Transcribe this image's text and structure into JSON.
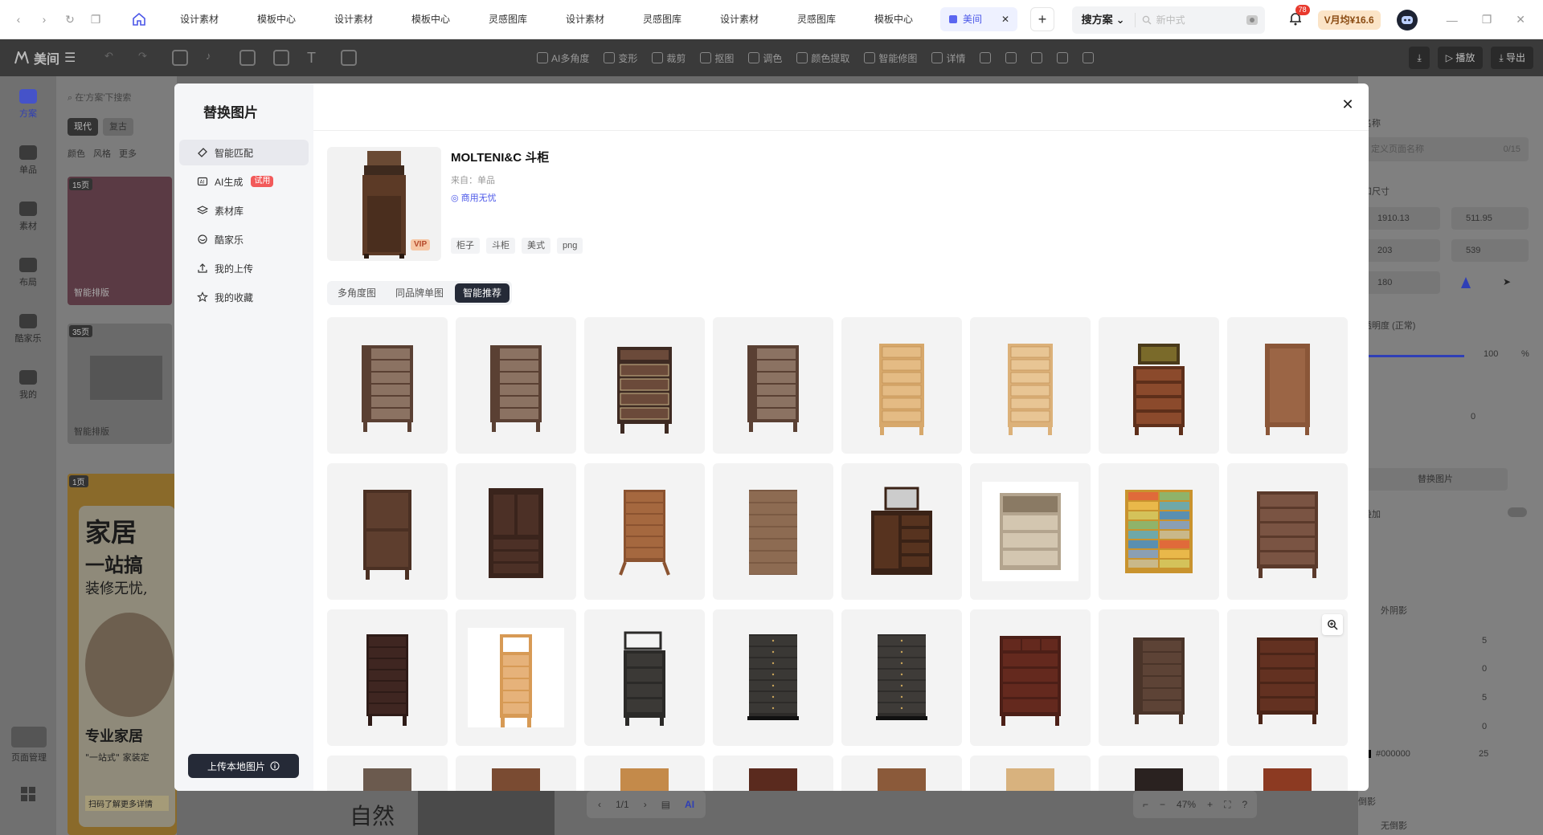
{
  "browser": {
    "tabs": [
      "设计素材",
      "模板中心",
      "设计素材",
      "模板中心",
      "灵感图库",
      "设计素材",
      "灵感图库",
      "设计素材",
      "灵感图库",
      "模板中心"
    ],
    "active_tab": "美间",
    "search_scope": "搜方案",
    "search_placeholder": "新中式",
    "notification_count": "78",
    "vip_label": "V月均¥16.6"
  },
  "app": {
    "logo": "美间",
    "tools": [
      "AI多角度",
      "变形",
      "裁剪",
      "抠图",
      "调色",
      "颜色提取",
      "智能修图",
      "详情"
    ],
    "play_label": "播放",
    "export_label": "导出"
  },
  "rail": [
    {
      "label": "方案",
      "active": true
    },
    {
      "label": "单品"
    },
    {
      "label": "素材"
    },
    {
      "label": "布局"
    },
    {
      "label": "酷家乐"
    },
    {
      "label": "我的"
    }
  ],
  "left_panel": {
    "search_placeholder": "在'方案'下搜索",
    "filters": [
      "现代",
      "复古"
    ],
    "dropdowns": [
      "颜色",
      "风格",
      "更多"
    ],
    "badges": [
      "15页",
      "35页",
      "1页"
    ],
    "smart_layout": "智能排版",
    "page_manage": "页面管理",
    "card_texts": [
      "家居",
      "一站搞",
      "装修无忧,",
      "专业家居",
      "\"一站式\" 家装定",
      "扫码了解更多详情"
    ]
  },
  "right_panel": {
    "name_label": "名称",
    "name_placeholder": "定义页面名称",
    "name_count": "0/15",
    "size_label": "和尺寸",
    "width": "1910.13",
    "height": "511.95",
    "x": "203",
    "y": "539",
    "rotate": "180",
    "opacity_label": "透明度 (正常)",
    "opacity_value": "100",
    "opacity_unit": "%",
    "other_value": "0",
    "replace_label": "替换图片",
    "overlay_label": "叠加",
    "shadow_label": "外阴影",
    "shadow_values": [
      "5",
      "0",
      "5",
      "0"
    ],
    "shadow_color": "#000000",
    "shadow_opacity": "25",
    "projection_label": "倒影",
    "projection_value": "无倒影"
  },
  "canvas": {
    "page": "1/1",
    "zoom": "47%",
    "text_big": "自然"
  },
  "modal": {
    "title": "替换图片",
    "nav": [
      {
        "label": "智能匹配",
        "icon": "magic-icon",
        "active": true
      },
      {
        "label": "AI生成",
        "icon": "ai-icon",
        "badge": "试用"
      },
      {
        "label": "素材库",
        "icon": "stack-icon"
      },
      {
        "label": "酷家乐",
        "icon": "cube-icon"
      },
      {
        "label": "我的上传",
        "icon": "upload-icon"
      },
      {
        "label": "我的收藏",
        "icon": "star-icon"
      }
    ],
    "upload_button": "上传本地图片",
    "product": {
      "name": "MOLTENI&C 斗柜",
      "source": "来自：单品",
      "commercial": "商用无忧",
      "vip": "VIP",
      "tags": [
        "柜子",
        "斗柜",
        "美式",
        "png"
      ]
    },
    "segments": [
      "多角度图",
      "同品牌单图",
      "智能推荐"
    ],
    "active_segment": "智能推荐",
    "items": [
      {
        "kind": "tall",
        "c": "#5a4033",
        "d": "#8b7262"
      },
      {
        "kind": "tall",
        "c": "#5a4033",
        "d": "#8b7262"
      },
      {
        "kind": "deco",
        "c": "#3e2a22",
        "d": "#6b4a3a"
      },
      {
        "kind": "tall",
        "c": "#5a4033",
        "d": "#8b7262"
      },
      {
        "kind": "light",
        "c": "#d7a86b",
        "d": "#e4bb84"
      },
      {
        "kind": "light",
        "c": "#dcb179",
        "d": "#e8c594"
      },
      {
        "kind": "stack",
        "c": "#5e2f1a",
        "d": "#8b4a2c"
      },
      {
        "kind": "plain",
        "c": "#8a5638",
        "d": "#9b6545"
      },
      {
        "kind": "two",
        "c": "#4b3023",
        "d": "#5e3e2e"
      },
      {
        "kind": "armoire",
        "c": "#3a241c",
        "d": "#4c3026"
      },
      {
        "kind": "leg",
        "c": "#8b5330",
        "d": "#a5683f"
      },
      {
        "kind": "block",
        "c": "#7b5a43",
        "d": "#8d6b52"
      },
      {
        "kind": "vanity",
        "c": "#3a2216",
        "d": "#57331f"
      },
      {
        "kind": "night",
        "c": "#b3a48e",
        "d": "#d3c6b0"
      },
      {
        "kind": "color",
        "c": "#c9932e",
        "d": "#7fa86a"
      },
      {
        "kind": "wide",
        "c": "#5b3a2b",
        "d": "#7a5443"
      },
      {
        "kind": "slim",
        "c": "#2e1b17",
        "d": "#3f2621"
      },
      {
        "kind": "shelf",
        "c": "#d79a55",
        "d": "#e6b27a"
      },
      {
        "kind": "mirror",
        "c": "#2b2a28",
        "d": "#3b3936"
      },
      {
        "kind": "black",
        "c": "#2d2b29",
        "d": "#3a3835"
      },
      {
        "kind": "black",
        "c": "#2f2d2b",
        "d": "#3e3b38"
      },
      {
        "kind": "red",
        "c": "#4c1f17",
        "d": "#64291e"
      },
      {
        "kind": "tall",
        "c": "#4a3429",
        "d": "#5d4336"
      },
      {
        "kind": "wide",
        "c": "#4b2518",
        "d": "#633121"
      },
      {
        "kind": "cut",
        "c": "#6b5a4e"
      },
      {
        "kind": "cut",
        "c": "#7a4b32"
      },
      {
        "kind": "cut",
        "c": "#c48a4a"
      },
      {
        "kind": "cut",
        "c": "#5a2a1e"
      },
      {
        "kind": "cut",
        "c": "#8b5a3a"
      },
      {
        "kind": "cut",
        "c": "#d8b27e"
      },
      {
        "kind": "cut",
        "c": "#2a2220"
      },
      {
        "kind": "cut",
        "c": "#8c3a22"
      }
    ]
  }
}
